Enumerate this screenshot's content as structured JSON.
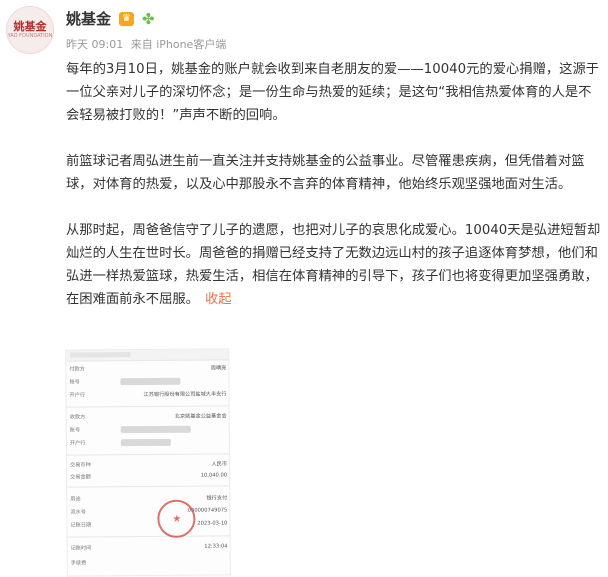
{
  "author": {
    "name": "姚基金",
    "avatar_text": "姚基金",
    "avatar_subtext": "YAO FOUNDATION",
    "badges": [
      "crown-icon",
      "clover-icon"
    ]
  },
  "meta": {
    "time": "昨天 09:01",
    "source": "来自 iPhone客户端"
  },
  "post": {
    "paragraphs": [
      "每年的3月10日，姚基金的账户就会收到来自老朋友的爱——10040元的爱心捐赠，这源于一位父亲对儿子的深切怀念；是一份生命与热爱的延续；是这句“我相信热爱体育的人是不会轻易被打败的！”声声不断的回响。",
      "前篮球记者周弘进生前一直关注并支持姚基金的公益事业。尽管罹患疾病，但凭借着对篮球，对体育的热爱，以及心中那股永不言弃的体育精神，他始终乐观坚强地面对生活。",
      "从那时起，周爸爸信守了儿子的遗愿，也把对儿子的哀思化成爱心。10040天是弘进短暂却灿烂的人生在世时长。周爸爸的捐赠已经支持了无数边远山村的孩子追逐体育梦想，他们和弘进一样热爱篮球，热爱生活，相信在体育精神的引导下，孩子们也将变得更加坚强勇敢，在困难面前永不屈服。"
    ],
    "collapse_label": "收起"
  },
  "receipt": {
    "rows": [
      {
        "label": "付款方",
        "value": "周晴亮"
      },
      {
        "label": "账号",
        "value": ""
      },
      {
        "label": "开户行",
        "value": "江苏银行股份有限公司盐城大丰支行"
      },
      {
        "label": "收款方",
        "value": "北京姚基金公益基金会"
      },
      {
        "label": "账号",
        "value": ""
      },
      {
        "label": "开户行",
        "value": ""
      },
      {
        "label": "交易币种",
        "value": "人民币"
      },
      {
        "label": "交易金额",
        "value": "10,040.00"
      },
      {
        "label": "用途",
        "value": "银行支付"
      },
      {
        "label": "流水号",
        "value": "000000749075"
      },
      {
        "label": "记账日期",
        "value": "2023-03-10"
      },
      {
        "label": "记账时间",
        "value": "12:33:04"
      },
      {
        "label": "手续费",
        "value": ""
      }
    ]
  },
  "colors": {
    "link": "#eb7350",
    "meta": "#9a9a9a",
    "text": "#333333",
    "stamp": "#d94a45"
  }
}
